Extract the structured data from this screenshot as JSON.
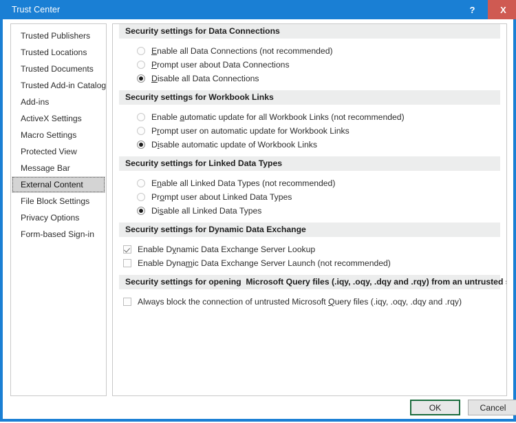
{
  "window": {
    "title": "Trust Center",
    "help_label": "?",
    "close_label": "X",
    "titlebar_color": "#1a7fd4",
    "close_color": "#cf5a52"
  },
  "sidebar": {
    "items": [
      {
        "label": "Trusted Publishers",
        "selected": false
      },
      {
        "label": "Trusted Locations",
        "selected": false
      },
      {
        "label": "Trusted Documents",
        "selected": false
      },
      {
        "label": "Trusted Add-in Catalogs",
        "selected": false
      },
      {
        "label": "Add-ins",
        "selected": false
      },
      {
        "label": "ActiveX Settings",
        "selected": false
      },
      {
        "label": "Macro Settings",
        "selected": false
      },
      {
        "label": "Protected View",
        "selected": false
      },
      {
        "label": "Message Bar",
        "selected": false
      },
      {
        "label": "External Content",
        "selected": true
      },
      {
        "label": "File Block Settings",
        "selected": false
      },
      {
        "label": "Privacy Options",
        "selected": false
      },
      {
        "label": "Form-based Sign-in",
        "selected": false
      }
    ]
  },
  "sections": [
    {
      "header": "Security settings for Data Connections",
      "type": "radio",
      "options": [
        {
          "pre": "",
          "accel": "E",
          "post": "nable all Data Connections (not recommended)",
          "checked": false
        },
        {
          "pre": "",
          "accel": "P",
          "post": "rompt user about Data Connections",
          "checked": false
        },
        {
          "pre": "",
          "accel": "D",
          "post": "isable all Data Connections",
          "checked": true
        }
      ]
    },
    {
      "header": "Security settings for Workbook Links",
      "type": "radio",
      "options": [
        {
          "pre": "Enable ",
          "accel": "a",
          "post": "utomatic update for all Workbook Links (not recommended)",
          "checked": false
        },
        {
          "pre": "P",
          "accel": "r",
          "post": "ompt user on automatic update for Workbook Links",
          "checked": false
        },
        {
          "pre": "D",
          "accel": "i",
          "post": "sable automatic update of Workbook Links",
          "checked": true
        }
      ]
    },
    {
      "header": "Security settings for Linked Data Types",
      "type": "radio",
      "options": [
        {
          "pre": "E",
          "accel": "n",
          "post": "able all Linked Data Types (not recommended)",
          "checked": false
        },
        {
          "pre": "Pr",
          "accel": "o",
          "post": "mpt user about Linked Data Types",
          "checked": false
        },
        {
          "pre": "Di",
          "accel": "s",
          "post": "able all Linked Data Types",
          "checked": true
        }
      ]
    },
    {
      "header": "Security settings for Dynamic Data Exchange",
      "type": "check",
      "options": [
        {
          "pre": "Enable D",
          "accel": "y",
          "post": "namic Data Exchange Server Lookup",
          "checked": true
        },
        {
          "pre": "Enable Dyna",
          "accel": "m",
          "post": "ic Data Exchange Server Launch (not recommended)",
          "checked": false
        }
      ]
    },
    {
      "header": "Security settings for opening  Microsoft Query files (.iqy, .oqy, .dqy and .rqy) from an untrusted source",
      "type": "check",
      "options": [
        {
          "pre": "Always block the connection of untrusted Microsoft ",
          "accel": "Q",
          "post": "uery files (.iqy, .oqy, .dqy and .rqy)",
          "checked": false
        }
      ]
    }
  ],
  "footer": {
    "ok_label": "OK",
    "cancel_label": "Cancel",
    "default_border_color": "#1a6b3c"
  }
}
